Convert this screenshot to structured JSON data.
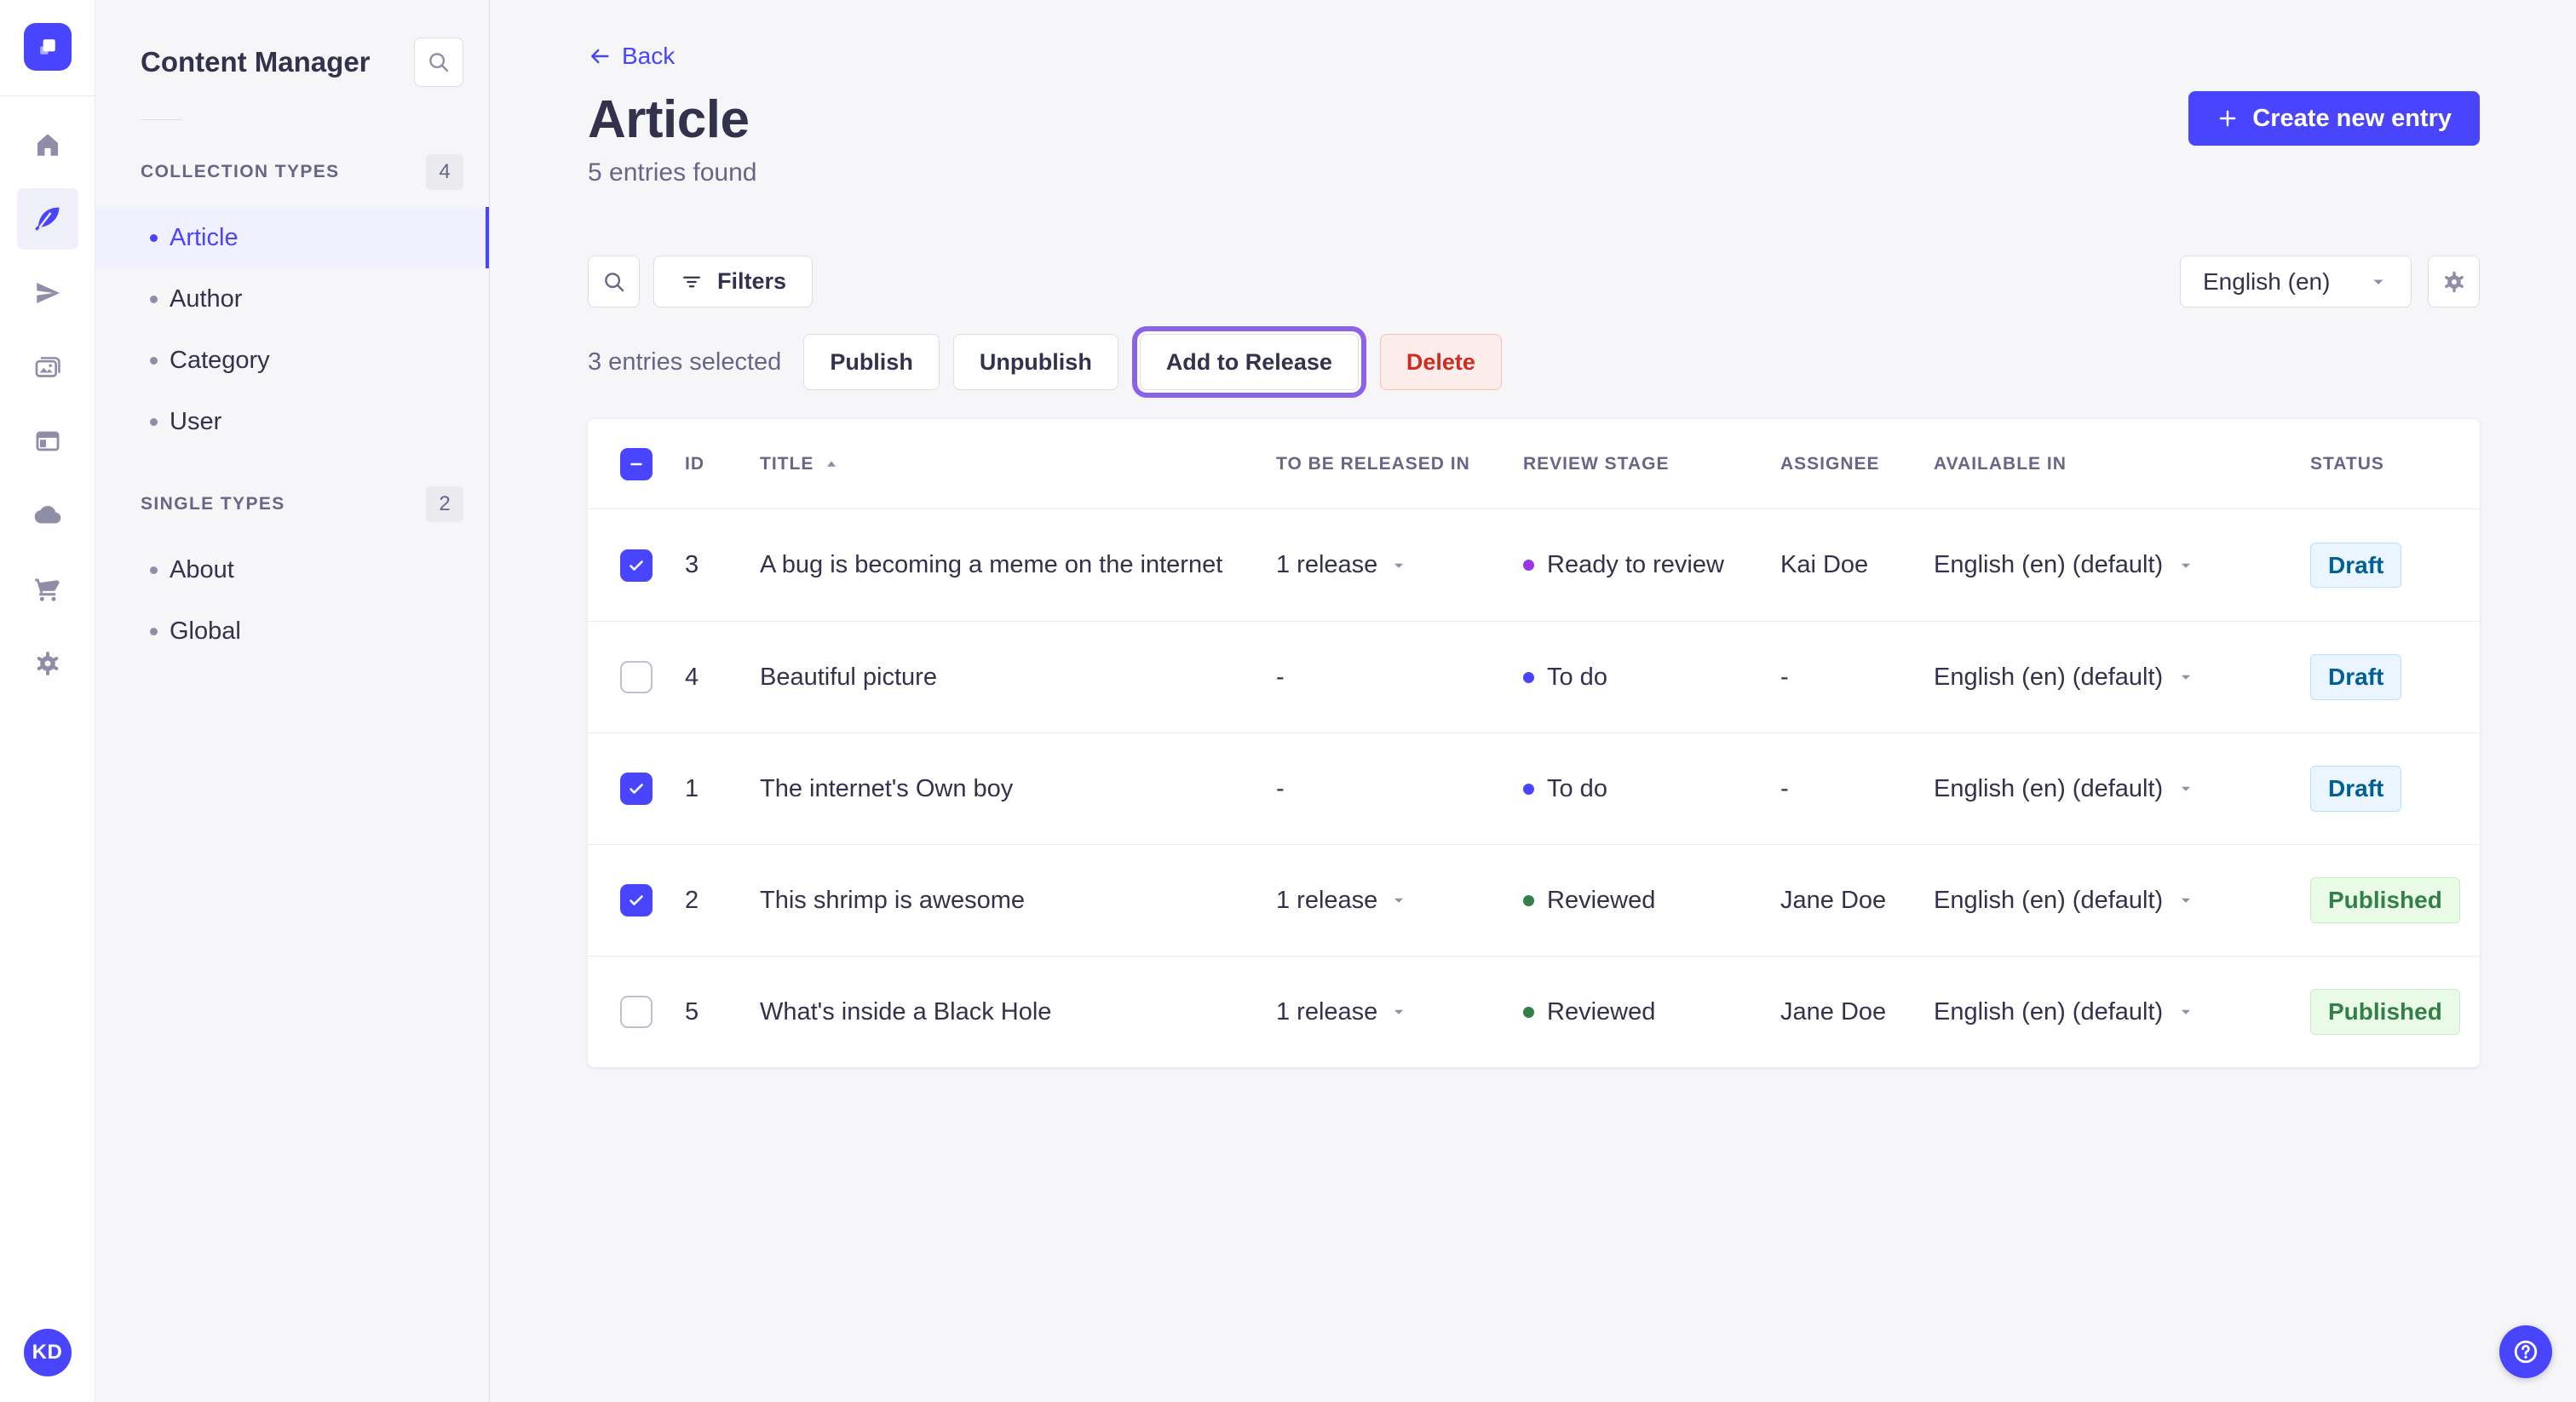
{
  "sidebar": {
    "title": "Content Manager",
    "sections": [
      {
        "label": "COLLECTION TYPES",
        "count": "4",
        "items": [
          {
            "label": "Article"
          },
          {
            "label": "Author"
          },
          {
            "label": "Category"
          },
          {
            "label": "User"
          }
        ]
      },
      {
        "label": "SINGLE TYPES",
        "count": "2",
        "items": [
          {
            "label": "About"
          },
          {
            "label": "Global"
          }
        ]
      }
    ]
  },
  "header": {
    "back_label": "Back",
    "title": "Article",
    "subtitle": "5 entries found",
    "create_button": "Create new entry"
  },
  "toolbar": {
    "filters_button": "Filters",
    "locale_select": "English (en)"
  },
  "selection": {
    "summary": "3 entries selected",
    "publish": "Publish",
    "unpublish": "Unpublish",
    "add_to_release": "Add to Release",
    "delete": "Delete"
  },
  "table": {
    "columns": {
      "id": "ID",
      "title": "TITLE",
      "release": "TO BE RELEASED IN",
      "review_stage": "REVIEW STAGE",
      "assignee": "ASSIGNEE",
      "available_in": "AVAILABLE IN",
      "status": "STATUS"
    },
    "rows": [
      {
        "checked": true,
        "id": "3",
        "title": "A bug is becoming a meme on the internet",
        "release": "1 release",
        "stage": "Ready to review",
        "assignee": "Kai Doe",
        "available_in": "English (en) (default)",
        "status": "Draft"
      },
      {
        "checked": false,
        "id": "4",
        "title": "Beautiful picture",
        "release": "-",
        "stage": "To do",
        "assignee": "-",
        "available_in": "English (en) (default)",
        "status": "Draft"
      },
      {
        "checked": true,
        "id": "1",
        "title": "The internet's Own boy",
        "release": "-",
        "stage": "To do",
        "assignee": "-",
        "available_in": "English (en) (default)",
        "status": "Draft"
      },
      {
        "checked": true,
        "id": "2",
        "title": "This shrimp is awesome",
        "release": "1 release",
        "stage": "Reviewed",
        "assignee": "Jane Doe",
        "available_in": "English (en) (default)",
        "status": "Published"
      },
      {
        "checked": false,
        "id": "5",
        "title": "What's inside a Black Hole",
        "release": "1 release",
        "stage": "Reviewed",
        "assignee": "Jane Doe",
        "available_in": "English (en) (default)",
        "status": "Published"
      }
    ]
  },
  "user": {
    "initials": "KD"
  },
  "colors": {
    "primary": "#4945ff",
    "highlight_ring": "#8c62ea",
    "stage_ready_to_review": "#9736e8",
    "stage_to_do": "#4945ff",
    "stage_reviewed": "#328048",
    "status_draft_text": "#006096",
    "status_published_text": "#328048",
    "danger_text": "#d02b20"
  }
}
